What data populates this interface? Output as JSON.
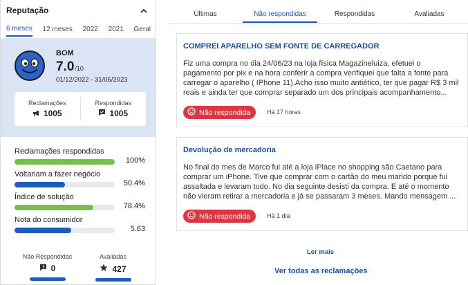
{
  "reputation": {
    "title": "Reputação",
    "period_tabs": [
      "6 meses",
      "12 meses",
      "2022",
      "2021",
      "Geral"
    ],
    "active_period": 0,
    "status": "BOM",
    "score": "7.0",
    "score_max": "/10",
    "date_range": "01/12/2022 - 31/05/2023",
    "complaints_label": "Reclamações",
    "complaints_value": "1005",
    "answered_label": "Respondidas",
    "answered_value": "1005",
    "metrics": [
      {
        "label": "Reclamações respondidas",
        "value": "100%",
        "fraction": 1.0,
        "color": "#73c04b"
      },
      {
        "label": "Voltariam a fazer negócio",
        "value": "50.4%",
        "fraction": 0.504,
        "color": "#1f5bbf"
      },
      {
        "label": "Índice de solução",
        "value": "78.4%",
        "fraction": 0.784,
        "color": "#73c04b"
      },
      {
        "label": "Nota do consumidor",
        "value": "5.63",
        "fraction": 0.563,
        "color": "#1f5bbf"
      }
    ],
    "not_answered_label": "Não Respondidas",
    "not_answered_value": "0",
    "evaluated_label": "Avaliadas",
    "evaluated_value": "427"
  },
  "tabs": [
    "Últimas",
    "Não respondidas",
    "Respondidas",
    "Avaliadas"
  ],
  "active_tab": 1,
  "complaints": [
    {
      "title": "COMPREI APARELHO SEM FONTE DE CARREGADOR",
      "body": "Fiz uma compra no dia 24/06/23 na loja física Magazineluiza, efetuei o pagamento por pix e na hora conferir a compra verifiquei que falta a fonte para carregar o aparelho ( IPhone 11).Acho isso muito antiético, ter que pagar R$ 3 mil reais e ainda ter que comprar separado um dos principais acompanhamento...",
      "status": "Não respondida",
      "time": "Há 17 horas"
    },
    {
      "title": "Devolução de mercadoria",
      "body": "No final do mes de Marco fui até a loja iPlace no shopping são Caetano para comprar um iPhone. Tive que comprar com o cartão do meu marido porque fui assaltada e levaram tudo. No dia seguinte desisti da compra. E até o momento não vieram retirar a mercadoria e já se passaram 3 meses. Mando mensagem ...",
      "status": "Não respondida",
      "time": "Há 1 dia"
    }
  ],
  "more_link": "Ler mais",
  "all_link": "Ver todas as reclamações",
  "colors": {
    "accent": "#1a56b8",
    "status_red": "#e03440",
    "panel_blue": "#dbe4f5"
  }
}
